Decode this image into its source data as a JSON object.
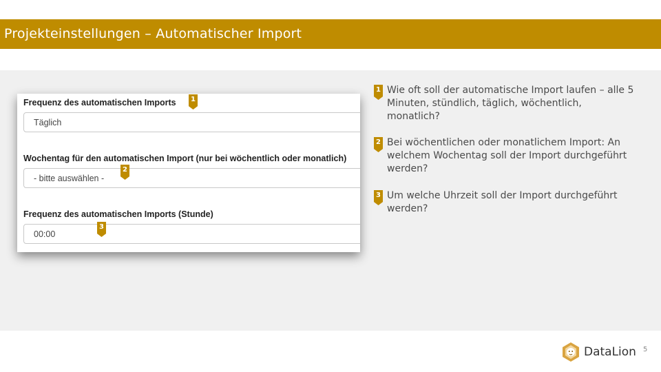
{
  "header": {
    "title": "Projekteinstellungen – Automatischer Import"
  },
  "form": {
    "fields": [
      {
        "label": "Frequenz des automatischen Imports",
        "value": "Täglich",
        "badge": "1"
      },
      {
        "label": "Wochentag für den automatischen Import (nur bei wöchentlich oder monatlich)",
        "value": "- bitte auswählen -",
        "badge": "2"
      },
      {
        "label": "Frequenz des automatischen Imports (Stunde)",
        "value": "00:00",
        "badge": "3"
      }
    ]
  },
  "notes": [
    {
      "badge": "1",
      "text": "Wie oft soll der automatische Import laufen – alle 5 Minuten, stündlich, täglich, wöchentlich, monatlich?"
    },
    {
      "badge": "2",
      "text": "Bei wöchentlichen oder monatlichem Import: An welchem Wochentag soll der Import durchgeführt werden?"
    },
    {
      "badge": "3",
      "text": "Um welche Uhrzeit soll der Import durchgeführt werden?"
    }
  ],
  "footer": {
    "brand": "DataLion",
    "page_number": "5"
  },
  "colors": {
    "accent": "#bf8c00",
    "content_bg": "#f0f0f0"
  },
  "icons": {
    "logo": "lion-head-icon"
  }
}
